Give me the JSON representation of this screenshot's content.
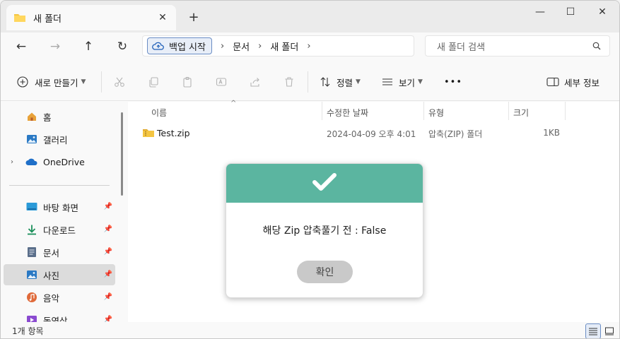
{
  "window": {
    "tab_title": "새 폴더",
    "tab_close": "✕",
    "new_tab": "+",
    "controls": {
      "minimize": "—",
      "maximize": "☐",
      "close": "✕"
    }
  },
  "nav": {
    "back": "←",
    "forward": "→",
    "up": "↑",
    "refresh": "↻"
  },
  "address": {
    "first_crumb": "백업 시작",
    "crumbs": [
      "문서",
      "새 폴더"
    ],
    "separator": "›"
  },
  "search": {
    "placeholder": "새 폴더 검색"
  },
  "toolbar": {
    "new_label": "새로 만들기",
    "sort_label": "정렬",
    "view_label": "보기",
    "more_label": "•••",
    "details_label": "세부 정보"
  },
  "sidebar": {
    "items": [
      {
        "label": "홈",
        "icon": "home-icon"
      },
      {
        "label": "갤러리",
        "icon": "gallery-icon"
      },
      {
        "label": "OneDrive",
        "icon": "cloud-icon",
        "expand": "›"
      },
      {
        "label": "바탕 화면",
        "icon": "desktop-icon"
      },
      {
        "label": "다운로드",
        "icon": "download-icon"
      },
      {
        "label": "문서",
        "icon": "document-icon"
      },
      {
        "label": "사진",
        "icon": "pictures-icon",
        "selected": true
      },
      {
        "label": "음악",
        "icon": "music-icon"
      },
      {
        "label": "동영상",
        "icon": "video-icon"
      }
    ]
  },
  "columns": {
    "name": "이름",
    "date": "수정한 날짜",
    "type": "유형",
    "size": "크기"
  },
  "files": [
    {
      "name": "Test.zip",
      "date": "2024-04-09 오후 4:01",
      "type": "압축(ZIP) 폴더",
      "size": "1KB"
    }
  ],
  "status": {
    "count": "1개 항목"
  },
  "dialog": {
    "message": "해당 Zip 압축풀기 전 : False",
    "ok_label": "확인",
    "header_color": "#5bb5a0"
  },
  "colors": {
    "accent": "#6a8dc4",
    "folder": "#f4c542"
  }
}
